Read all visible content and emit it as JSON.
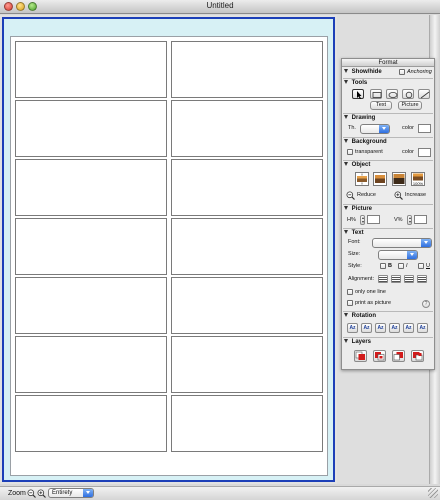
{
  "window": {
    "title": "Untitled"
  },
  "statusbar": {
    "zoom_label": "Zoom",
    "zoom_mode": "Entirety"
  },
  "palette": {
    "title": "Format",
    "showhide": {
      "label": "Show/hide",
      "anchoring": "Anchoring"
    },
    "tools": {
      "heading": "Tools",
      "text_button": "Text",
      "picture_button": "Picture"
    },
    "drawing": {
      "heading": "Drawing",
      "thickness_label": "Th.",
      "color_label": "color"
    },
    "background": {
      "heading": "Background",
      "transparent_label": "transparent",
      "color_label": "color"
    },
    "object": {
      "heading": "Object",
      "tile4_label": "100%",
      "reduce_label": "Reduce",
      "increase_label": "Increase"
    },
    "picture": {
      "heading": "Picture",
      "h_label": "H%",
      "v_label": "V%"
    },
    "text": {
      "heading": "Text",
      "font_label": "Font:",
      "size_label": "Size:",
      "style_label": "Style:",
      "bold": "B",
      "italic": "I",
      "underline": "U",
      "alignment_label": "Alignment:",
      "only_one_line": "only one line",
      "print_as_picture": "print as picture",
      "help": "?"
    },
    "rotation": {
      "heading": "Rotation",
      "buttons": [
        "Az",
        "Az",
        "Az",
        "Az",
        "Az",
        "Az"
      ]
    },
    "layers": {
      "heading": "Layers"
    }
  },
  "colors": {
    "frame_border": "#1c3fb8",
    "frame_fill": "#d7f1f5",
    "layer_red": "#d21b1b"
  }
}
